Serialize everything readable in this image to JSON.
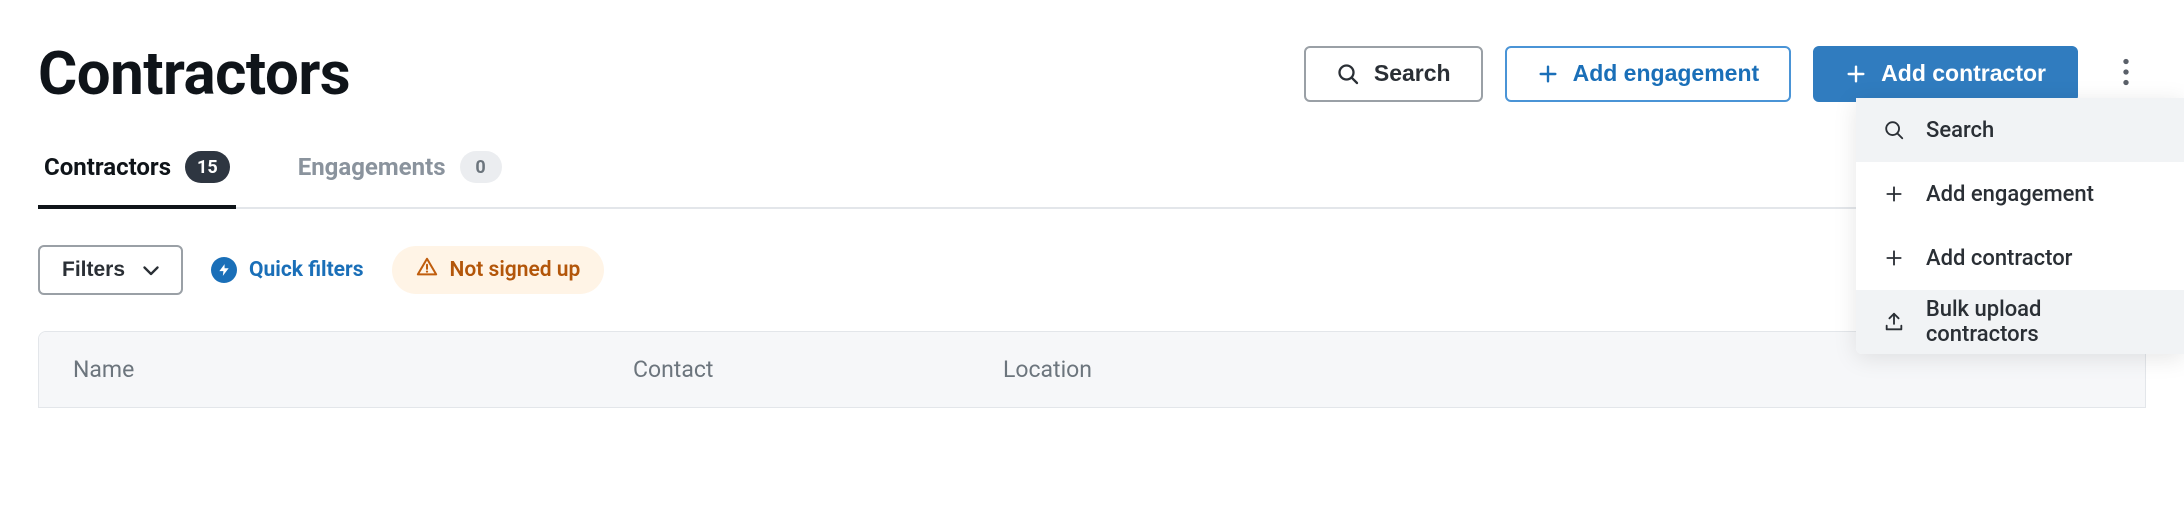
{
  "header": {
    "title": "Contractors",
    "search_label": "Search",
    "add_engagement_label": "Add engagement",
    "add_contractor_label": "Add contractor"
  },
  "tabs": {
    "contractors": {
      "label": "Contractors",
      "count": "15"
    },
    "engagements": {
      "label": "Engagements",
      "count": "0"
    }
  },
  "filters": {
    "filters_label": "Filters",
    "quick_filters_label": "Quick filters",
    "chip_not_signed_up": "Not signed up"
  },
  "table": {
    "columns": {
      "name": "Name",
      "contact": "Contact",
      "location": "Location"
    }
  },
  "dropdown": {
    "search": "Search",
    "add_engagement": "Add engagement",
    "add_contractor": "Add contractor",
    "bulk_upload": "Bulk upload contractors"
  }
}
